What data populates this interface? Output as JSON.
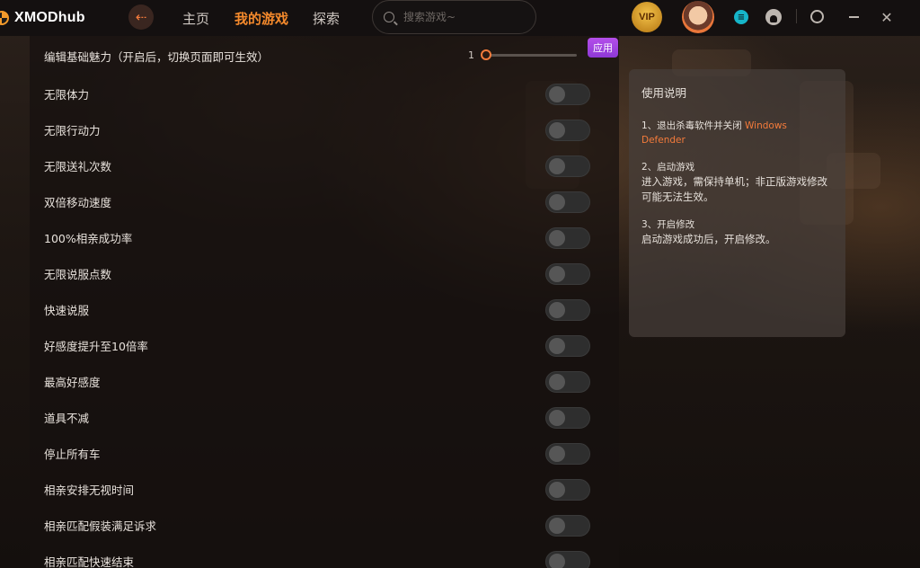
{
  "app": {
    "logo_text": "XMODhub"
  },
  "nav": {
    "back_icon": "arrow-left",
    "items": [
      {
        "label": "主页",
        "active": false
      },
      {
        "label": "我的游戏",
        "active": true
      },
      {
        "label": "探索",
        "active": false
      }
    ]
  },
  "search": {
    "placeholder": "搜索游戏~"
  },
  "topbar_right": {
    "vip_label": "VIP",
    "icons": [
      "vip-badge-icon",
      "avatar",
      "cyan-app-icon",
      "bell-icon",
      "settings-icon",
      "minimize-icon",
      "close-icon"
    ]
  },
  "colors": {
    "accent": "#f47b3b",
    "nav_active": "#f58a2c",
    "apply_button": "#a044e0",
    "toggle_off": "#2e2e2e"
  },
  "first_row": {
    "label": "编辑基础魅力（开启后，切换页面即可生效）",
    "slider_value": "1",
    "apply_label": "应用"
  },
  "toggles": [
    {
      "label": "无限体力",
      "on": false
    },
    {
      "label": "无限行动力",
      "on": false
    },
    {
      "label": "无限送礼次数",
      "on": false
    },
    {
      "label": "双倍移动速度",
      "on": false
    },
    {
      "label": "100%相亲成功率",
      "on": false
    },
    {
      "label": "无限说服点数",
      "on": false
    },
    {
      "label": "快速说服",
      "on": false
    },
    {
      "label": "好感度提升至10倍率",
      "on": false
    },
    {
      "label": "最高好感度",
      "on": false
    },
    {
      "label": "道具不减",
      "on": false
    },
    {
      "label": "停止所有车",
      "on": false
    },
    {
      "label": "相亲安排无视时间",
      "on": false
    },
    {
      "label": "相亲匹配假装满足诉求",
      "on": false
    },
    {
      "label": "相亲匹配快速结束",
      "on": false
    }
  ],
  "instructions": {
    "title": "使用说明",
    "steps": [
      {
        "head": "1、退出杀毒软件并关闭",
        "head_highlight": "Windows Defender",
        "body": ""
      },
      {
        "head": "2、启动游戏",
        "head_highlight": "",
        "body": "进入游戏，需保持单机；非正版游戏修改可能无法生效。"
      },
      {
        "head": "3、开启修改",
        "head_highlight": "",
        "body": "启动游戏成功后，开启修改。"
      }
    ]
  }
}
